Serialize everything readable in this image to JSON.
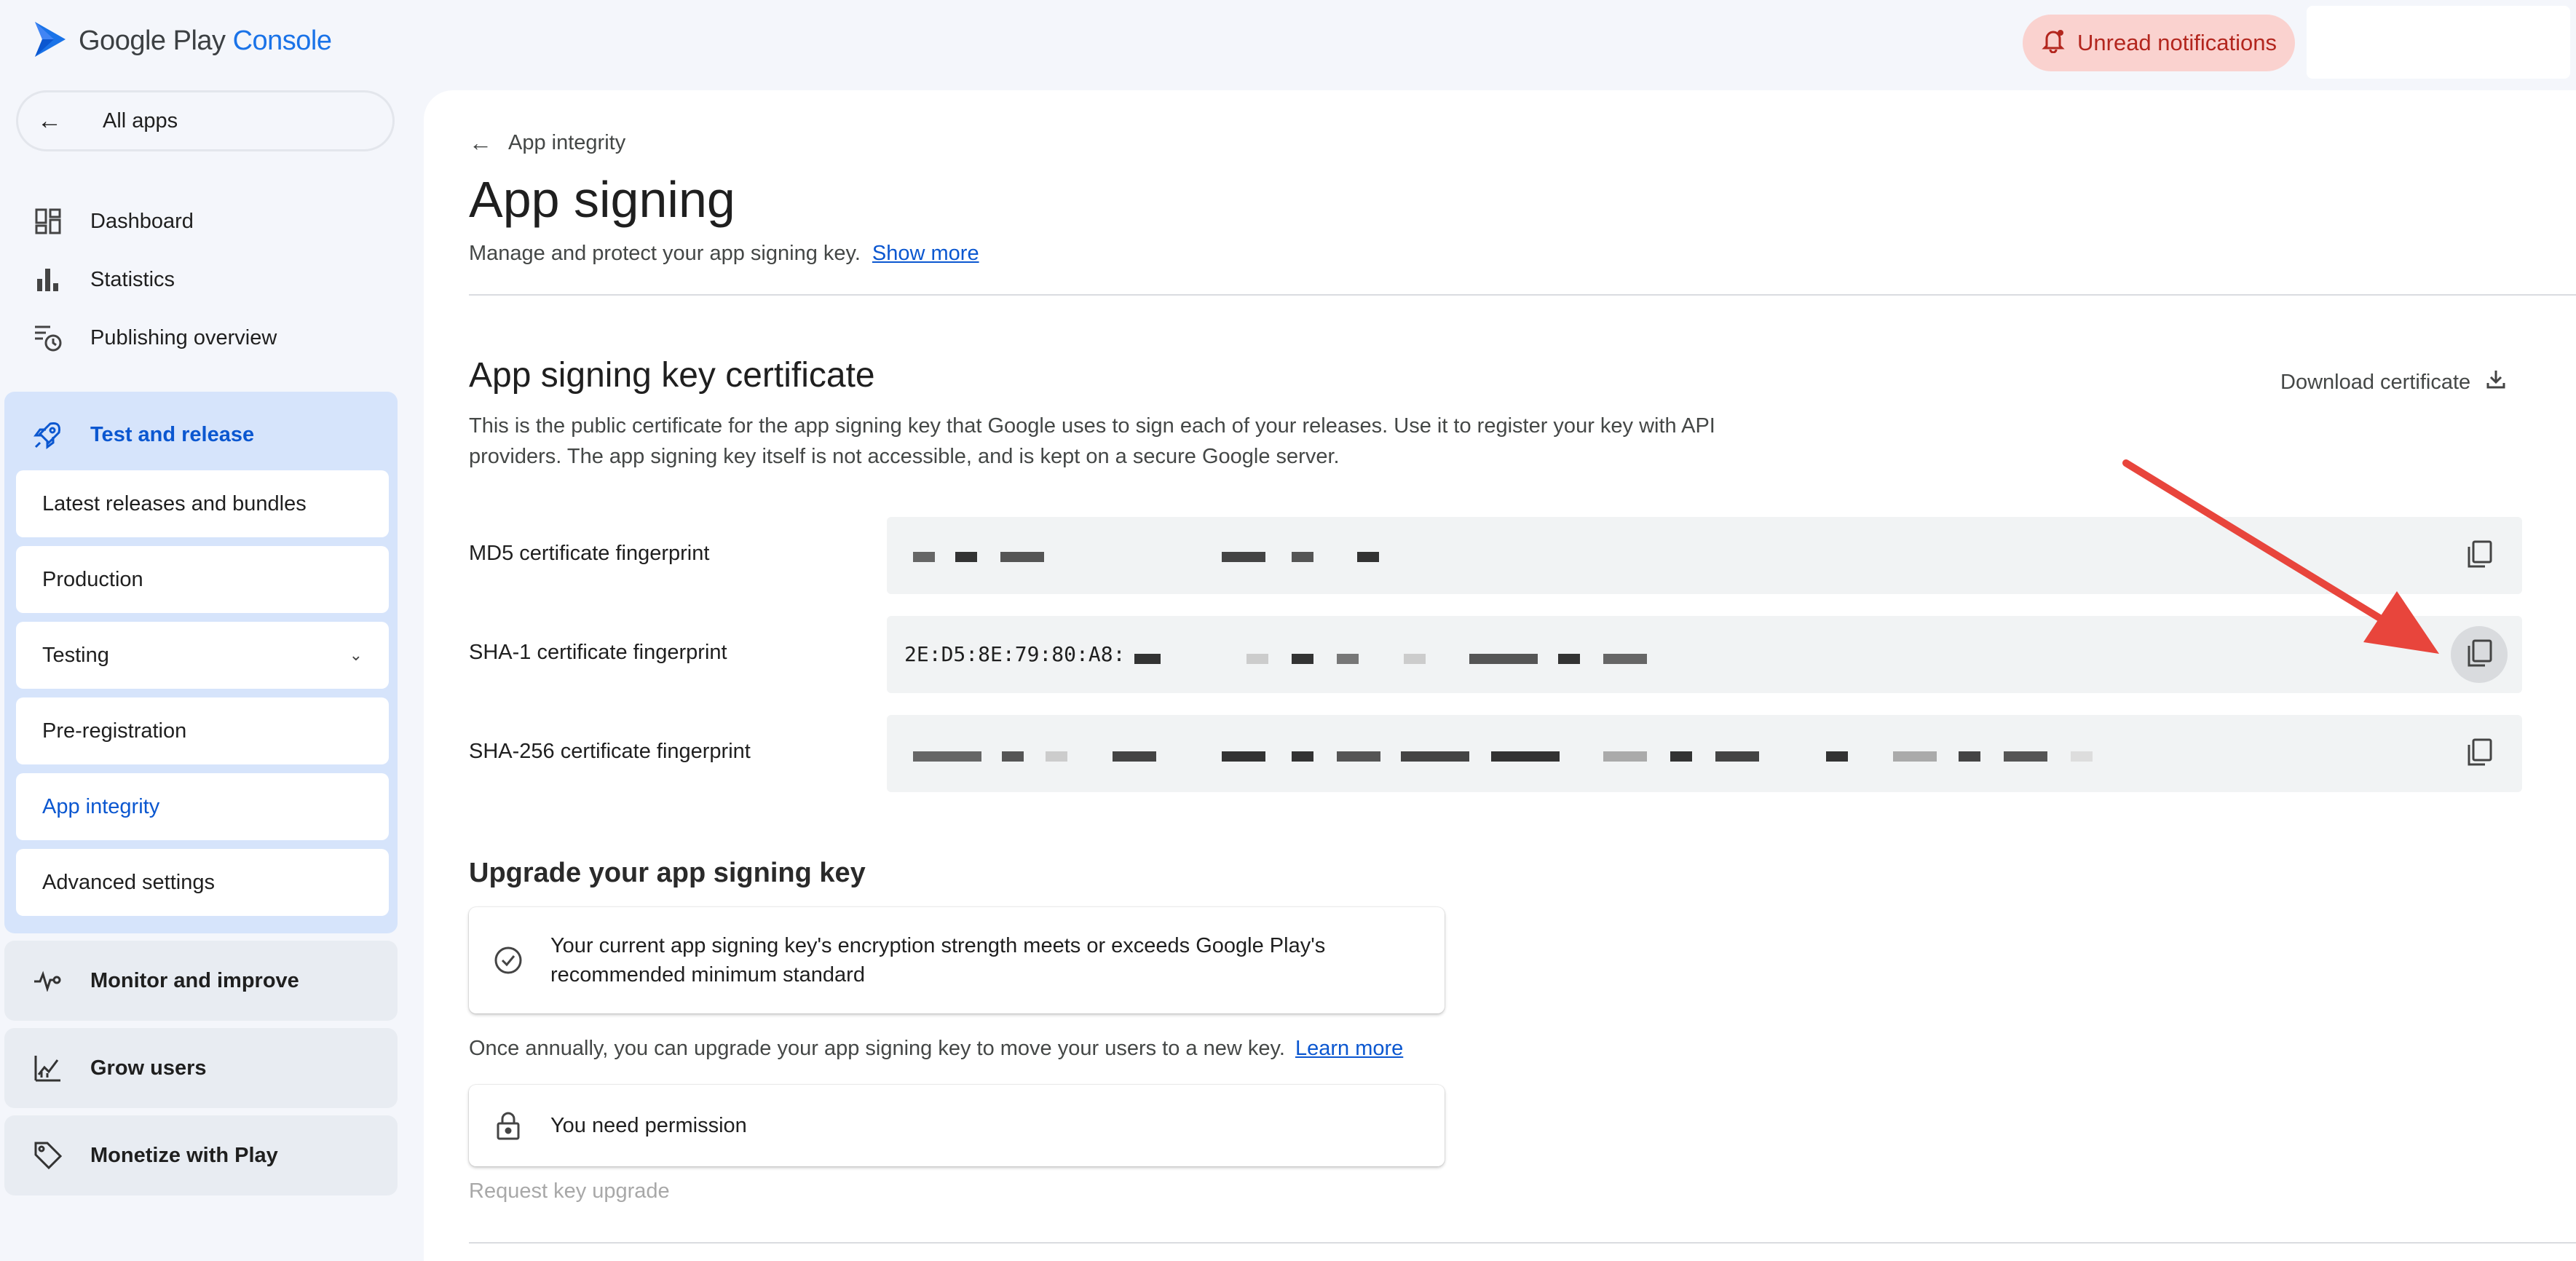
{
  "app": {
    "logo_name": "Google Play",
    "logo_suffix": "Console",
    "notifications_label": "Unread notifications"
  },
  "sidebar": {
    "all_apps": "All apps",
    "items": [
      {
        "label": "Dashboard",
        "icon": "dashboard-icon"
      },
      {
        "label": "Statistics",
        "icon": "bar-chart-icon"
      },
      {
        "label": "Publishing overview",
        "icon": "publishing-icon"
      }
    ],
    "test_release": {
      "label": "Test and release",
      "icon": "rocket-icon",
      "children": [
        {
          "label": "Latest releases and bundles"
        },
        {
          "label": "Production"
        },
        {
          "label": "Testing"
        },
        {
          "label": "Pre-registration"
        },
        {
          "label": "App integrity"
        },
        {
          "label": "Advanced settings"
        }
      ]
    },
    "groups": [
      {
        "label": "Monitor and improve",
        "icon": "pulse-icon"
      },
      {
        "label": "Grow users",
        "icon": "growth-chart-icon"
      },
      {
        "label": "Monetize with Play",
        "icon": "tag-icon"
      }
    ]
  },
  "main": {
    "breadcrumb": "App integrity",
    "title": "App signing",
    "subtitle": "Manage and protect your app signing key.",
    "show_more": "Show more",
    "certificate": {
      "title": "App signing key certificate",
      "description": "This is the public certificate for the app signing key that Google uses to sign each of your releases. Use it to register your key with API providers. The app signing key itself is not accessible, and is kept on a secure Google server.",
      "download_label": "Download certificate",
      "fingerprints": [
        {
          "label": "MD5 certificate fingerprint",
          "value": ""
        },
        {
          "label": "SHA-1 certificate fingerprint",
          "value": "2E:D5:8E:79:80:A8:"
        },
        {
          "label": "SHA-256 certificate fingerprint",
          "value": ""
        }
      ]
    },
    "upgrade": {
      "title": "Upgrade your app signing key",
      "strength_message": "Your current app signing key's encryption strength meets or exceeds Google Play's recommended minimum standard",
      "annual_note": "Once annually, you can upgrade your app signing key to move your users to a new key.",
      "learn_more": "Learn more",
      "permission_message": "You need permission",
      "request_button": "Request key upgrade"
    }
  },
  "colors": {
    "accent": "#0b57d0",
    "annotation_arrow": "#e8453c",
    "notification_bg": "#fad2cf"
  }
}
